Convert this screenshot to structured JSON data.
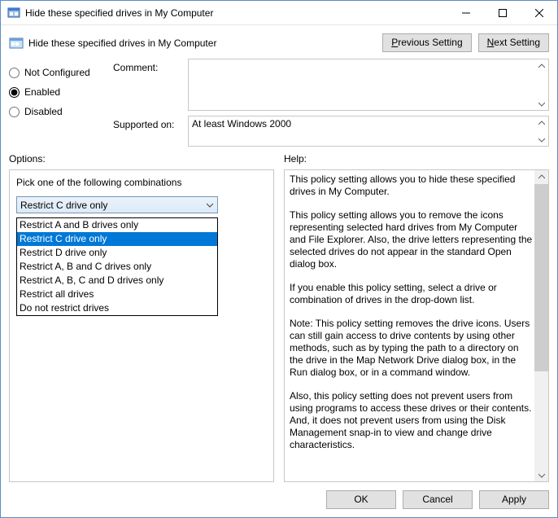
{
  "window": {
    "title": "Hide these specified drives in My Computer"
  },
  "header": {
    "policy_name": "Hide these specified drives in My Computer",
    "prev_label_pre": "P",
    "prev_label_post": "revious Setting",
    "next_label_pre": "N",
    "next_label_post": "ext Setting"
  },
  "state": {
    "not_configured": "Not Configured",
    "enabled": "Enabled",
    "disabled": "Disabled",
    "selected": "enabled"
  },
  "fields": {
    "comment_label": "Comment:",
    "comment_value": "",
    "supported_label": "Supported on:",
    "supported_value": "At least Windows 2000"
  },
  "labels": {
    "options": "Options:",
    "help": "Help:"
  },
  "options": {
    "prompt": "Pick one of the following combinations",
    "selected": "Restrict C drive only",
    "items": [
      "Restrict A and B drives only",
      "Restrict C drive only",
      "Restrict D drive only",
      "Restrict A, B and C drives only",
      "Restrict A, B, C and D drives only",
      "Restrict all drives",
      "Do not restrict drives"
    ]
  },
  "help": {
    "p1": "This policy setting allows you to hide these specified drives in My Computer.",
    "p2": "This policy setting allows you to remove the icons representing selected hard drives from My Computer and File Explorer. Also, the drive letters representing the selected drives do not appear in the standard Open dialog box.",
    "p3": "If you enable this policy setting, select a drive or combination of drives in the drop-down list.",
    "p4": "Note: This policy setting removes the drive icons. Users can still gain access to drive contents by using other methods, such as by typing the path to a directory on the drive in the Map Network Drive dialog box, in the Run dialog box, or in a command window.",
    "p5": "Also, this policy setting does not prevent users from using programs to access these drives or their contents. And, it does not prevent users from using the Disk Management snap-in to view and change drive characteristics."
  },
  "footer": {
    "ok": "OK",
    "cancel": "Cancel",
    "apply": "Apply"
  }
}
